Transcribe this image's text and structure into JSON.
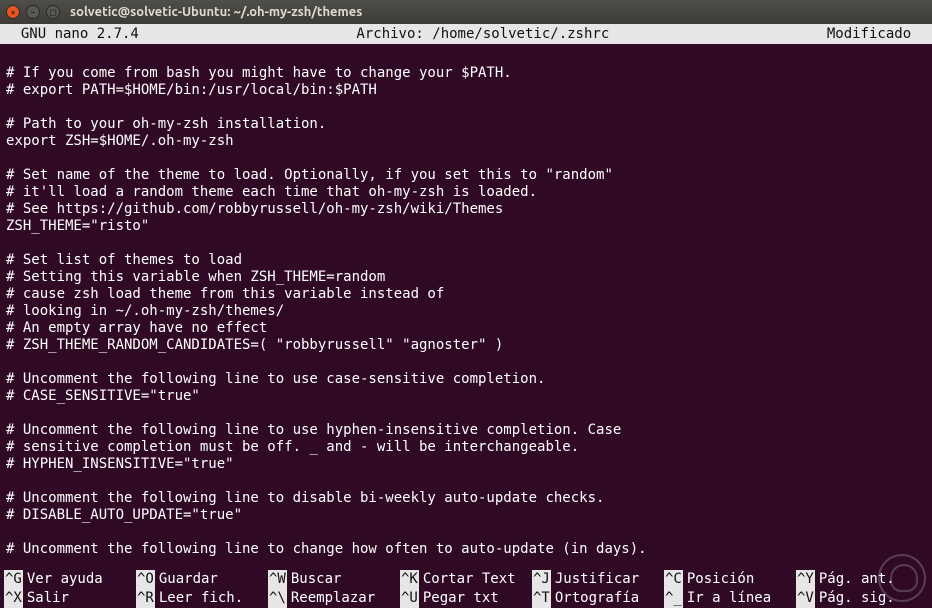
{
  "window": {
    "title": "solvetic@solvetic-Ubuntu: ~/.oh-my-zsh/themes"
  },
  "status": {
    "left": "  GNU nano 2.7.4",
    "center": "Archivo: /home/solvetic/.zshrc",
    "right": "Modificado  "
  },
  "lines": [
    "",
    "# If you come from bash you might have to change your $PATH.",
    "# export PATH=$HOME/bin:/usr/local/bin:$PATH",
    "",
    "# Path to your oh-my-zsh installation.",
    "export ZSH=$HOME/.oh-my-zsh",
    "",
    "# Set name of the theme to load. Optionally, if you set this to \"random\"",
    "# it'll load a random theme each time that oh-my-zsh is loaded.",
    "# See https://github.com/robbyrussell/oh-my-zsh/wiki/Themes",
    "ZSH_THEME=\"risto\"",
    "",
    "# Set list of themes to load",
    "# Setting this variable when ZSH_THEME=random",
    "# cause zsh load theme from this variable instead of",
    "# looking in ~/.oh-my-zsh/themes/",
    "# An empty array have no effect",
    "# ZSH_THEME_RANDOM_CANDIDATES=( \"robbyrussell\" \"agnoster\" )",
    "",
    "# Uncomment the following line to use case-sensitive completion.",
    "# CASE_SENSITIVE=\"true\"",
    "",
    "# Uncomment the following line to use hyphen-insensitive completion. Case",
    "# sensitive completion must be off. _ and - will be interchangeable.",
    "# HYPHEN_INSENSITIVE=\"true\"",
    "",
    "# Uncomment the following line to disable bi-weekly auto-update checks.",
    "# DISABLE_AUTO_UPDATE=\"true\"",
    "",
    "# Uncomment the following line to change how often to auto-update (in days)."
  ],
  "shortcuts": {
    "row1": [
      {
        "key": "^G",
        "label": "Ver ayuda"
      },
      {
        "key": "^O",
        "label": "Guardar"
      },
      {
        "key": "^W",
        "label": "Buscar"
      },
      {
        "key": "^K",
        "label": "Cortar Text"
      },
      {
        "key": "^J",
        "label": "Justificar"
      },
      {
        "key": "^C",
        "label": "Posición"
      },
      {
        "key": "^Y",
        "label": "Pág. ant."
      }
    ],
    "row2": [
      {
        "key": "^X",
        "label": "Salir"
      },
      {
        "key": "^R",
        "label": "Leer fich."
      },
      {
        "key": "^\\",
        "label": "Reemplazar"
      },
      {
        "key": "^U",
        "label": "Pegar txt"
      },
      {
        "key": "^T",
        "label": "Ortografía"
      },
      {
        "key": "^_",
        "label": "Ir a línea"
      },
      {
        "key": "^V",
        "label": "Pág. sig."
      }
    ]
  }
}
